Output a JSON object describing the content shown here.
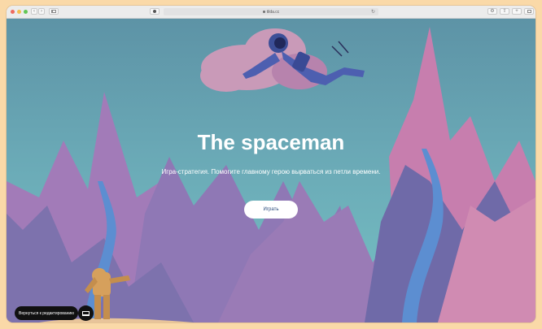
{
  "browser": {
    "url": "tilda.cc"
  },
  "hero": {
    "title": "The spaceman",
    "subtitle": "Игра-стратегия. Помогите главному герою вырваться из петли времени.",
    "play_label": "Играть"
  },
  "editor": {
    "back_label": "Вернуться к редактированию"
  },
  "colors": {
    "frame": "#fad9a8",
    "sky_top": "#5d93a6",
    "sky_bottom": "#76c1c4",
    "mountain_purple": "#7d72ad",
    "mountain_pink": "#c07fae",
    "water": "#5c8ed1",
    "button_text": "#2a4b7c"
  }
}
